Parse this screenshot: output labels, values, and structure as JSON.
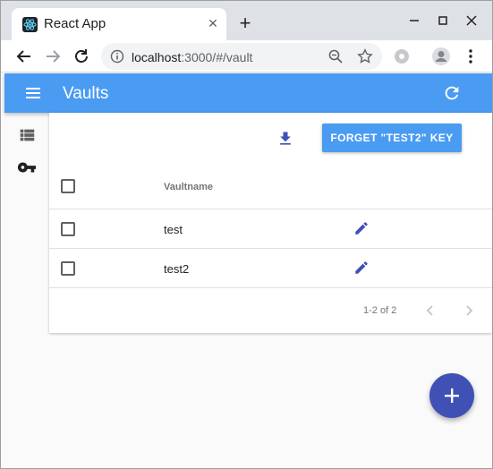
{
  "browser": {
    "tab_title": "React App",
    "url_host": "localhost",
    "url_path": ":3000/#/vault"
  },
  "app": {
    "title": "Vaults"
  },
  "toolbar": {
    "forget_button_label": "FORGET \"TEST2\" KEY"
  },
  "table": {
    "column_header": "Vaultname",
    "rows": [
      {
        "name": "test"
      },
      {
        "name": "test2"
      }
    ],
    "pagination": "1-2 of 2"
  },
  "colors": {
    "app_bar": "#4a9bf2",
    "accent": "#3f51b5"
  }
}
